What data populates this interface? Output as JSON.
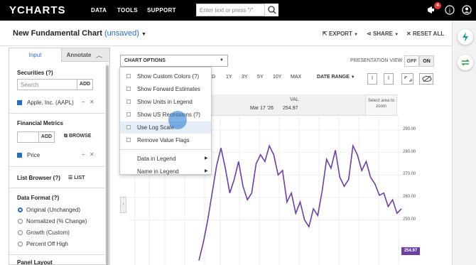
{
  "nav": {
    "logo": "YCHARTS",
    "links": [
      "DATA",
      "TOOLS",
      "SUPPORT"
    ],
    "search_placeholder": "Enter text or press \"/\"",
    "notification_count": "4"
  },
  "header": {
    "title": "New Fundamental Chart",
    "status": "(unsaved)",
    "export_label": "EXPORT",
    "share_label": "SHARE",
    "reset_label": "RESET ALL"
  },
  "sidebar": {
    "tabs": [
      "Input",
      "Annotate"
    ],
    "securities_title": "Securities (?)",
    "search_placeholder": "Search",
    "add_label": "ADD",
    "security_item": "Apple, Inc. (AAPL)",
    "metrics_title": "Financial Metrics",
    "browse_label": "BROWSE",
    "metric_item": "Price",
    "list_browser_title": "List Browser (?)",
    "list_label": "LIST",
    "data_format_title": "Data Format (?)",
    "formats": [
      "Original (Unchanged)",
      "Normalized (% Change)",
      "Growth (Custom)",
      "Percent Off High"
    ],
    "selected_format": "Original (Unchanged)",
    "panel_layout_title": "Panel Layout"
  },
  "toolbar": {
    "chart_options_label": "CHART OPTIONS",
    "presentation_label": "PRESENTATION VIEW",
    "off_label": "OFF",
    "on_label": "ON",
    "ranges": [
      "D",
      "1Y",
      "3Y",
      "5Y",
      "10Y",
      "MAX"
    ],
    "date_range_label": "DATE RANGE",
    "small_btns": [
      "I",
      "I"
    ]
  },
  "chart_options_menu": {
    "items": [
      {
        "label": "Show Custom Colors (?)",
        "checked": false
      },
      {
        "label": "Show Forward Estimates",
        "checked": false
      },
      {
        "label": "Show Units in Legend",
        "checked": false
      },
      {
        "label": "Show US Recessions (?)",
        "checked": false
      },
      {
        "label": "Use Log Scale",
        "checked": false,
        "highlighted": true
      },
      {
        "label": "Remove Value Flags",
        "checked": false
      }
    ],
    "submenus": [
      "Data in Legend",
      "Name in Legend"
    ]
  },
  "legend": {
    "val_header": "VAL",
    "date": "Mar 17 '26",
    "value": "254.97",
    "select_area": "Select area to zoom"
  },
  "chart_data": {
    "type": "line",
    "yticks": [
      "290.00",
      "280.00",
      "270.00",
      "260.00",
      "250.00"
    ],
    "ylim": [
      250,
      290
    ],
    "series": [
      {
        "color": "#6b3fa0",
        "values": [
          232,
          240,
          250,
          262,
          274,
          282,
          273,
          262,
          268,
          276,
          265,
          259,
          262,
          275,
          279,
          276,
          283,
          279,
          270,
          272,
          258,
          262,
          253,
          258,
          250,
          247,
          255,
          252,
          263,
          277,
          273,
          281,
          269,
          265,
          268,
          283,
          279,
          272,
          276,
          269,
          266,
          261,
          262,
          256,
          259,
          253,
          254.97
        ]
      }
    ],
    "last_value_label": "254.97"
  }
}
